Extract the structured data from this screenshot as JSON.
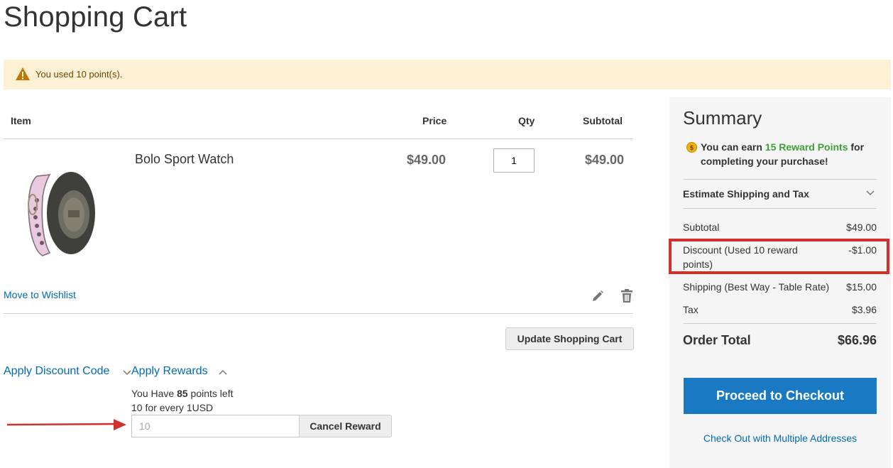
{
  "page": {
    "title": "Shopping Cart"
  },
  "notice": {
    "text": "You used 10 point(s).",
    "icon": "warning-icon"
  },
  "cart": {
    "columns": {
      "item": "Item",
      "price": "Price",
      "qty": "Qty",
      "subtotal": "Subtotal"
    },
    "items": [
      {
        "name": "Bolo Sport Watch",
        "price": "$49.00",
        "qty": "1",
        "subtotal": "$49.00",
        "image": "bolo-sport-watch-image"
      }
    ],
    "move_to_wishlist": "Move to Wishlist",
    "update_button": "Update Shopping Cart"
  },
  "discount": {
    "title": "Apply Discount Code"
  },
  "rewards": {
    "title": "Apply Rewards",
    "have_prefix": "You Have ",
    "points_left": "85",
    "have_suffix": " points left",
    "rate": "10 for every 1USD",
    "input_value": "10",
    "cancel_button": "Cancel Reward"
  },
  "summary": {
    "title": "Summary",
    "earn_prefix": "You can earn ",
    "earn_points": "15 Reward Points",
    "earn_suffix": " for",
    "earn_line2": "completing your purchase!",
    "estimate_label": "Estimate Shipping and Tax",
    "rows": [
      {
        "label": "Subtotal",
        "value": "$49.00"
      },
      {
        "label": "Discount (Used 10 reward",
        "label2": "points)",
        "value": "-$1.00"
      },
      {
        "label": "Shipping (Best Way - Table Rate)",
        "value": "$15.00"
      },
      {
        "label": "Tax",
        "value": "$3.96"
      }
    ],
    "order_total_label": "Order Total",
    "order_total_value": "$66.96",
    "checkout_button": "Proceed to Checkout",
    "multi_address_link": "Check Out with Multiple Addresses"
  },
  "colors": {
    "link": "#006bb4",
    "primary_button": "#1979c3",
    "notice_bg": "#fdf0d5",
    "reward_green": "#3fa037",
    "highlight_red": "#d0312d"
  }
}
